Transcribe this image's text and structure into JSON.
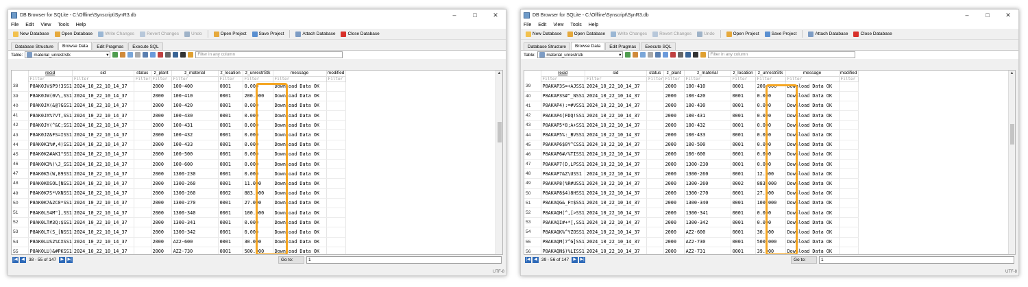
{
  "windows": [
    {
      "title": "DB Browser for SQLite - C:\\Offline\\Synscript\\SynR3.db",
      "menu": [
        "File",
        "Edit",
        "View",
        "Tools",
        "Help"
      ],
      "toolbar": [
        "New Database",
        "Open Database",
        "Write Changes",
        "Revert Changes",
        "Undo",
        "Open Project",
        "Save Project",
        "Attach Database",
        "Close Database"
      ],
      "tabs": [
        "Database Structure",
        "Browse Data",
        "Edit Pragmas",
        "Execute SQL"
      ],
      "table_label": "Table:",
      "table_name": "material_unrestrstk",
      "filter_placeholder": "Filter in any column",
      "columns": [
        "recid",
        "sid",
        "status",
        "z_plant",
        "z_material",
        "z_location",
        "z_unrestrStk",
        "message",
        "modified"
      ],
      "filter_text": "Filter",
      "rows": [
        [
          "38",
          "P8AK0JV$P9!3SS1",
          "2024_10_22_10_14_37",
          "",
          "2000",
          "100-400",
          "0001",
          "0.000",
          "Download Data OK",
          ""
        ],
        [
          "39",
          "P8AK0JW(0V\\,SS1",
          "2024_10_22_10_14_37",
          "",
          "2000",
          "100-410",
          "0001",
          "200.000",
          "Download Data OK",
          ""
        ],
        [
          "40",
          "P8AK0JX(&@?GSS1",
          "2024_10_22_10_14_37",
          "",
          "2000",
          "100-420",
          "0001",
          "0.000",
          "Download Data OK",
          ""
        ],
        [
          "41",
          "P8AK0JX%7VT,SS1",
          "2024_10_22_10_14_37",
          "",
          "2000",
          "100-430",
          "0001",
          "0.000",
          "Download Data OK",
          ""
        ],
        [
          "42",
          "P8AK0JY(^&C;SS1",
          "2024_10_22_10_14_37",
          "",
          "2000",
          "100-431",
          "0001",
          "0.000",
          "Download Data OK",
          ""
        ],
        [
          "43",
          "P8AK0JZ&FS=ISS1",
          "2024_10_22_10_14_37",
          "",
          "2000",
          "100-432",
          "0001",
          "0.000",
          "Download Data OK",
          ""
        ],
        [
          "44",
          "P8AK0K1%#,4)SS1",
          "2024_10_22_10_14_37",
          "",
          "2000",
          "100-433",
          "0001",
          "0.000",
          "Download Data OK",
          ""
        ],
        [
          "45",
          "P8AK0K2#AK1\"SS1",
          "2024_10_22_10_14_37",
          "",
          "2000",
          "100-500",
          "0001",
          "0.000",
          "Download Data OK",
          ""
        ],
        [
          "46",
          "P8AK0K3%)\\J_SS1",
          "2024_10_22_10_14_37",
          "",
          "2000",
          "100-600",
          "0001",
          "0.000",
          "Download Data OK",
          ""
        ],
        [
          "47",
          "P8AK0K5(W,89SS1",
          "2024_10_22_10_14_37",
          "",
          "2000",
          "1300-230",
          "0001",
          "0.000",
          "Download Data OK",
          ""
        ],
        [
          "48",
          "P8AK0K6SOL[NSS1",
          "2024_10_22_10_14_37",
          "",
          "2000",
          "1300-260",
          "0001",
          "11.000",
          "Download Data OK",
          ""
        ],
        [
          "49",
          "P8AK0K7S*VXNSS1",
          "2024_10_22_10_14_37",
          "",
          "2000",
          "1300-260",
          "0002",
          "883.000",
          "Download Data OK",
          ""
        ],
        [
          "50",
          "P8AK0K7&2C0*SS1",
          "2024_10_22_10_14_37",
          "",
          "2000",
          "1300-270",
          "0001",
          "27.000",
          "Download Data OK",
          ""
        ],
        [
          "51",
          "P8AK0LS4M\"],SS1",
          "2024_10_22_10_14_37",
          "",
          "2000",
          "1300-340",
          "0001",
          "100.000",
          "Download Data OK",
          ""
        ],
        [
          "52",
          "P8AK0LT#3Q:$SS1",
          "2024_10_22_10_14_37",
          "",
          "2000",
          "1300-341",
          "0001",
          "0.000",
          "Download Data OK",
          ""
        ],
        [
          "53",
          "P8AK0LT(S_[NSS1",
          "2024_10_22_10_14_37",
          "",
          "2000",
          "1300-342",
          "0001",
          "0.000",
          "Download Data OK",
          ""
        ],
        [
          "54",
          "P8AK0LUS2%CXSS1",
          "2024_10_22_10_14_37",
          "",
          "2000",
          "AZ2-600",
          "0001",
          "30.000",
          "Download Data OK",
          ""
        ],
        [
          "55",
          "P8AK0LU)&#PKSS1",
          "2024_10_22_10_14_37",
          "",
          "2000",
          "AZ2-730",
          "0001",
          "500.000",
          "Download Data OK",
          ""
        ]
      ],
      "nav_text": "38 - 55 of 147",
      "goto_label": "Go to:",
      "goto_value": "1",
      "status": "UTF-8"
    },
    {
      "title": "DB Browser for SQLite - C:\\Offline\\Synscript\\SynR3.db",
      "menu": [
        "File",
        "Edit",
        "View",
        "Tools",
        "Help"
      ],
      "toolbar": [
        "New Database",
        "Open Database",
        "Write Changes",
        "Revert Changes",
        "Undo",
        "Open Project",
        "Save Project",
        "Attach Database",
        "Close Database"
      ],
      "tabs": [
        "Database Structure",
        "Browse Data",
        "Edit Pragmas",
        "Execute SQL"
      ],
      "table_label": "Table:",
      "table_name": "material_unrestrstk",
      "filter_placeholder": "Filter in any column",
      "columns": [
        "recid",
        "sid",
        "status",
        "z_plant",
        "z_material",
        "z_location",
        "z_unrestrStk",
        "message",
        "modified"
      ],
      "filter_text": "Filter",
      "rows": [
        [
          "39",
          "P8AKAP3S=+AJSS1",
          "2024_10_22_10_14_37",
          "",
          "2000",
          "100-410",
          "0001",
          "200.000",
          "Download Data OK",
          ""
        ],
        [
          "40",
          "P8AKAP3S#\"_NSS1",
          "2024_10_22_10_14_37",
          "",
          "2000",
          "100-420",
          "0001",
          "0.000",
          "Download Data OK",
          ""
        ],
        [
          "41",
          "P8AKAP4):=#VSS1",
          "2024_10_22_10_14_37",
          "",
          "2000",
          "100-430",
          "0001",
          "0.000",
          "Download Data OK",
          ""
        ],
        [
          "42",
          "P8AKAP4(FDQ!SS1",
          "2024_10_22_10_14_37",
          "",
          "2000",
          "100-431",
          "0001",
          "0.000",
          "Download Data OK",
          ""
        ],
        [
          "43",
          "P8AKAP5*8;A+SS1",
          "2024_10_22_10_14_37",
          "",
          "2000",
          "100-432",
          "0001",
          "0.000",
          "Download Data OK",
          ""
        ],
        [
          "44",
          "P8AKAP5%:_BVSS1",
          "2024_10_22_10_14_37",
          "",
          "2000",
          "100-433",
          "0001",
          "0.000",
          "Download Data OK",
          ""
        ],
        [
          "45",
          "P8AKAP6$0Y^CSS1",
          "2024_10_22_10_14_37",
          "",
          "2000",
          "100-500",
          "0001",
          "0.000",
          "Download Data OK",
          ""
        ],
        [
          "46",
          "P8AKAP6#/%TISS1",
          "2024_10_22_10_14_37",
          "",
          "2000",
          "100-600",
          "0001",
          "0.000",
          "Download Data OK",
          ""
        ],
        [
          "47",
          "P8AKAP7(D,LPSS1",
          "2024_10_22_10_14_37",
          "",
          "2000",
          "1300-230",
          "0001",
          "0.000",
          "Download Data OK",
          ""
        ],
        [
          "48",
          "P8AKAP7&Z\\USS1",
          "2024_10_22_10_14_37",
          "",
          "2000",
          "1300-260",
          "0001",
          "12.000",
          "Download Data OK",
          ""
        ],
        [
          "49",
          "P8AKAP8(%R#USS1",
          "2024_10_22_10_14_37",
          "",
          "2000",
          "1300-260",
          "0002",
          "883.000",
          "Download Data OK",
          ""
        ],
        [
          "50",
          "P8AKAP8$4)8HSS1",
          "2024_10_22_10_14_37",
          "",
          "2000",
          "1300-270",
          "0001",
          "27.000",
          "Download Data OK",
          ""
        ],
        [
          "51",
          "P8AKAQG&_F=$SS1",
          "2024_10_22_10_14_37",
          "",
          "2000",
          "1300-340",
          "0001",
          "100.000",
          "Download Data OK",
          ""
        ],
        [
          "52",
          "P8AKAQH(^,[>SS1",
          "2024_10_22_10_14_37",
          "",
          "2000",
          "1300-341",
          "0001",
          "0.000",
          "Download Data OK",
          ""
        ],
        [
          "53",
          "P8AKAQI#+*[,SS1",
          "2024_10_22_10_14_37",
          "",
          "2000",
          "1300-342",
          "0001",
          "0.000",
          "Download Data OK",
          ""
        ],
        [
          "54",
          "P8AKAQK%^YZOSS1",
          "2024_10_22_10_14_37",
          "",
          "2000",
          "AZ2-600",
          "0001",
          "30.000",
          "Download Data OK",
          ""
        ],
        [
          "55",
          "P8AKAQM(7^G]SS1",
          "2024_10_22_10_14_37",
          "",
          "2000",
          "AZ2-730",
          "0001",
          "500.000",
          "Download Data OK",
          ""
        ],
        [
          "56",
          "P8AKAQN$)%LISS1",
          "2024_10_22_10_14_37",
          "",
          "2000",
          "AZ2-731",
          "0001",
          "39.000",
          "Download Data OK",
          ""
        ]
      ],
      "nav_text": "39 - 56 of 147",
      "goto_label": "Go to:",
      "goto_value": "1",
      "status": "UTF-8"
    }
  ],
  "colors": {
    "highlight": "#f5a623",
    "nav_button": "#2e6ab8"
  }
}
